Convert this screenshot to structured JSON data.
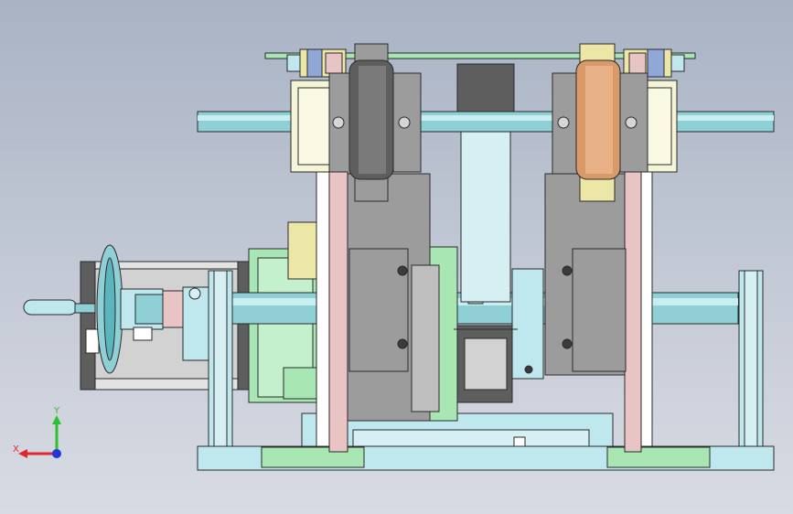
{
  "viewport": {
    "background_top": "#a9b3c4",
    "background_bottom": "#d8dbe3"
  },
  "model": {
    "colors": {
      "frame_cyan": "#bfe7ee",
      "base_green": "#a8e6b4",
      "shaft_cyan": "#8fd0d6",
      "gray_plate": "#9c9c9c",
      "dark_roller": "#5e5e5e",
      "copper_roller": "#d99a6a",
      "pink_arm": "#e8c4c4",
      "yellow_part": "#ece7a6",
      "outline": "#2a2a2a"
    }
  },
  "triad": {
    "x_label": "X",
    "y_label": "Y",
    "x_color": "#e3262b",
    "y_color": "#2fc02f",
    "z_color": "#2436d6"
  }
}
